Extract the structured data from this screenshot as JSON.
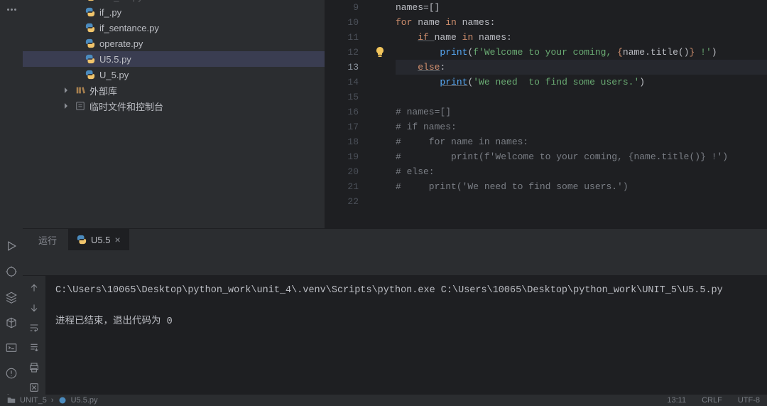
{
  "tree": {
    "items": [
      {
        "label": "dict_list.py",
        "indent": 70,
        "icon": "py",
        "faded": true
      },
      {
        "label": "if_.py",
        "indent": 70,
        "icon": "py"
      },
      {
        "label": "if_sentance.py",
        "indent": 70,
        "icon": "py"
      },
      {
        "label": "operate.py",
        "indent": 70,
        "icon": "py"
      },
      {
        "label": "U5.5.py",
        "indent": 70,
        "icon": "py",
        "selected": true
      },
      {
        "label": "U_5.py",
        "indent": 70,
        "icon": "py"
      },
      {
        "label": "外部库",
        "indent": 36,
        "icon": "lib",
        "chevron": "right"
      },
      {
        "label": "临时文件和控制台",
        "indent": 36,
        "icon": "scratch",
        "chevron": "right"
      }
    ]
  },
  "editor": {
    "lines": [
      {
        "n": 9,
        "tokens": [
          {
            "t": "names",
            "c": "def"
          },
          {
            "t": "=",
            "c": "def"
          },
          {
            "t": "[]",
            "c": "def"
          }
        ]
      },
      {
        "n": 10,
        "tokens": [
          {
            "t": "for ",
            "c": "kw"
          },
          {
            "t": "name ",
            "c": "def"
          },
          {
            "t": "in ",
            "c": "kw"
          },
          {
            "t": "names:",
            "c": "def"
          }
        ]
      },
      {
        "n": 11,
        "tokens": [
          {
            "t": "    ",
            "c": "def"
          },
          {
            "t": "if ",
            "c": "kw",
            "ul": true
          },
          {
            "t": "name ",
            "c": "def"
          },
          {
            "t": "in ",
            "c": "kw"
          },
          {
            "t": "names:",
            "c": "def"
          }
        ]
      },
      {
        "n": 12,
        "bulb": true,
        "tokens": [
          {
            "t": "        ",
            "c": "def"
          },
          {
            "t": "print",
            "c": "fn"
          },
          {
            "t": "(",
            "c": "def"
          },
          {
            "t": "f'Welcome to your coming, ",
            "c": "str"
          },
          {
            "t": "{",
            "c": "brace"
          },
          {
            "t": "name.title()",
            "c": "tmpl"
          },
          {
            "t": "}",
            "c": "brace"
          },
          {
            "t": " !'",
            "c": "str"
          },
          {
            "t": ")",
            "c": "def"
          }
        ]
      },
      {
        "n": 13,
        "current": true,
        "tokens": [
          {
            "t": "    ",
            "c": "def"
          },
          {
            "t": "else",
            "c": "kw",
            "ul": true
          },
          {
            "t": ":",
            "c": "def"
          }
        ]
      },
      {
        "n": 14,
        "tokens": [
          {
            "t": "        ",
            "c": "def"
          },
          {
            "t": "print",
            "c": "fn",
            "ul": true
          },
          {
            "t": "(",
            "c": "def"
          },
          {
            "t": "'We need  to find some users.'",
            "c": "str"
          },
          {
            "t": ")",
            "c": "def"
          }
        ]
      },
      {
        "n": 15,
        "tokens": []
      },
      {
        "n": 16,
        "tokens": [
          {
            "t": "# names=[]",
            "c": "cmt"
          }
        ]
      },
      {
        "n": 17,
        "tokens": [
          {
            "t": "# if names:",
            "c": "cmt"
          }
        ]
      },
      {
        "n": 18,
        "tokens": [
          {
            "t": "#     for name in names:",
            "c": "cmt"
          }
        ]
      },
      {
        "n": 19,
        "tokens": [
          {
            "t": "#         print(f'Welcome to your coming, {name.title()} !')",
            "c": "cmt"
          }
        ]
      },
      {
        "n": 20,
        "tokens": [
          {
            "t": "# else:",
            "c": "cmt"
          }
        ]
      },
      {
        "n": 21,
        "tokens": [
          {
            "t": "#     print('We need to find some users.')",
            "c": "cmt"
          }
        ]
      },
      {
        "n": 22,
        "tokens": []
      }
    ]
  },
  "panel": {
    "label_run": "运行",
    "tab_label": "U5.5",
    "output_cmd": "C:\\Users\\10065\\Desktop\\python_work\\unit_4\\.venv\\Scripts\\python.exe C:\\Users\\10065\\Desktop\\python_work\\UNIT_5\\U5.5.py",
    "output_end": "进程已结束，退出代码为 0"
  },
  "status": {
    "crumb_dir": "UNIT_5",
    "crumb_file": "U5.5.py",
    "pos": "13:11",
    "eol": "CRLF",
    "enc": "UTF-8"
  }
}
